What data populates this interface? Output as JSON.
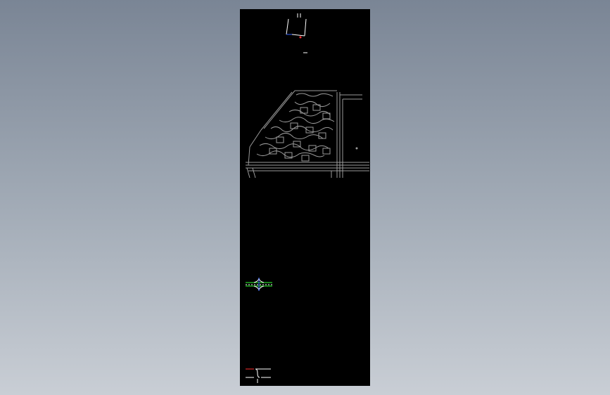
{
  "viewport": {
    "background_top": "#7a8595",
    "background_bottom": "#c9ced5"
  },
  "drawing_sheet": {
    "background": "#000000",
    "line_color": "#9a9a9a",
    "accent_colors": {
      "blue": "#3060ff",
      "red": "#ff3030",
      "green": "#30ff30",
      "white": "#ffffff"
    },
    "elements": [
      {
        "name": "coordinate-axes-icon"
      },
      {
        "name": "site-plan-drawing"
      },
      {
        "name": "road-intersection-detail"
      },
      {
        "name": "corner-detail-symbol"
      }
    ]
  }
}
